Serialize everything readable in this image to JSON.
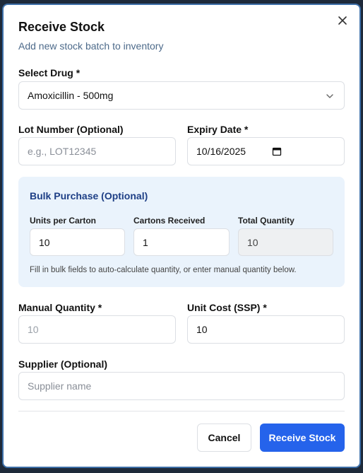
{
  "dialog": {
    "title": "Receive Stock",
    "subtitle": "Add new stock batch to inventory"
  },
  "drug": {
    "label": "Select Drug *",
    "value": "Amoxicillin - 500mg"
  },
  "lot": {
    "label": "Lot Number (Optional)",
    "placeholder": "e.g., LOT12345"
  },
  "expiry": {
    "label": "Expiry Date *",
    "value": "10/16/2025"
  },
  "bulk": {
    "title": "Bulk Purchase (Optional)",
    "units_label": "Units per Carton",
    "units_value": "10",
    "cartons_label": "Cartons Received",
    "cartons_value": "1",
    "total_label": "Total Quantity",
    "total_value": "10",
    "hint": "Fill in bulk fields to auto-calculate quantity, or enter manual quantity below."
  },
  "manual_qty": {
    "label": "Manual Quantity *",
    "value": "10"
  },
  "unit_cost": {
    "label": "Unit Cost (SSP) *",
    "value": "10"
  },
  "supplier": {
    "label": "Supplier (Optional)",
    "placeholder": "Supplier name"
  },
  "actions": {
    "cancel_label": "Cancel",
    "submit_label": "Receive Stock"
  },
  "colors": {
    "accent": "#2563eb",
    "bulk_bg": "#eaf3fc",
    "bulk_title": "#1e3f86"
  },
  "icons": {
    "close": "close-icon",
    "select": "chevron-down-icon",
    "date": "calendar-icon"
  }
}
